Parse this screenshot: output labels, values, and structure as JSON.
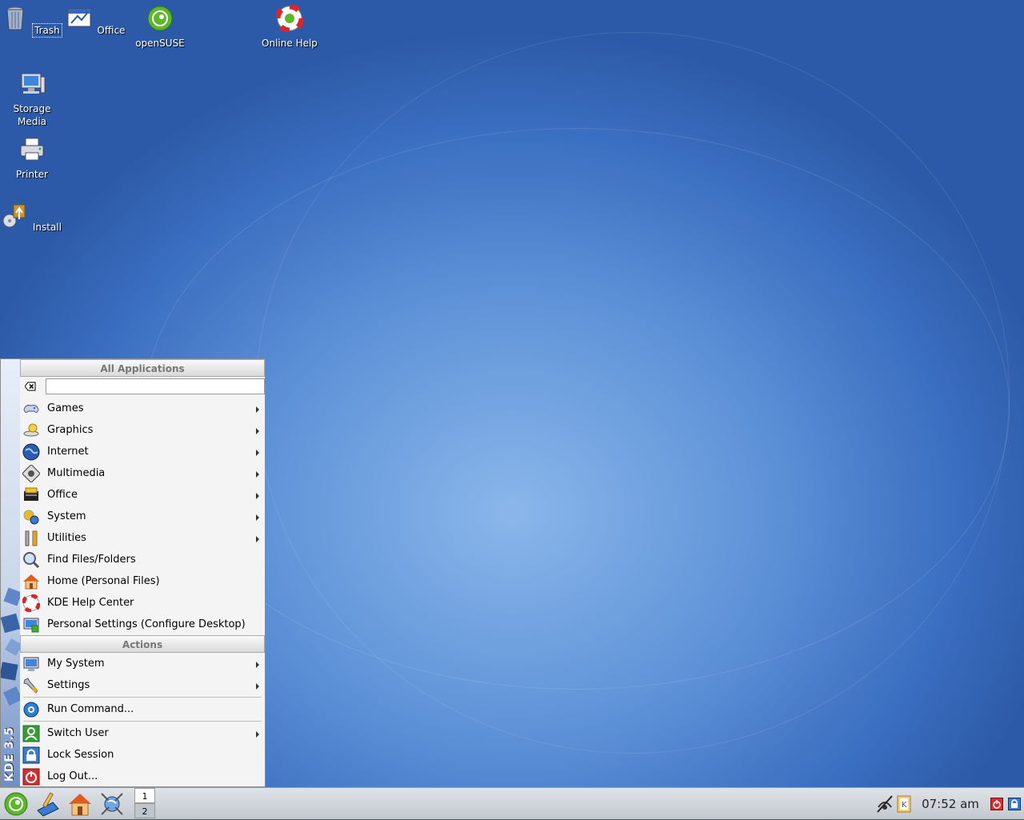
{
  "desktop": {
    "icons": [
      {
        "label": "Trash",
        "icon": "trash-icon"
      },
      {
        "label": "Office",
        "icon": "office-icon"
      },
      {
        "label": "openSUSE",
        "icon": "opensuse-icon"
      },
      {
        "label": "Online Help",
        "icon": "help-lifebuoy-icon"
      },
      {
        "label": "Storage Media",
        "icon": "storage-media-icon"
      },
      {
        "label": "Printer",
        "icon": "printer-icon"
      },
      {
        "label": "Install",
        "icon": "install-icon"
      }
    ]
  },
  "kmenu": {
    "sidebar_label": "KDE 3.5",
    "all_apps_title": "All Applications",
    "search": {
      "value": "",
      "placeholder": ""
    },
    "app_items": [
      {
        "label": "Games",
        "icon": "games-controller-icon",
        "submenu": true
      },
      {
        "label": "Graphics",
        "icon": "graphics-icon",
        "submenu": true
      },
      {
        "label": "Internet",
        "icon": "internet-globe-icon",
        "submenu": true
      },
      {
        "label": "Multimedia",
        "icon": "multimedia-icon",
        "submenu": true
      },
      {
        "label": "Office",
        "icon": "office-icon",
        "submenu": true
      },
      {
        "label": "System",
        "icon": "system-gears-icon",
        "submenu": true
      },
      {
        "label": "Utilities",
        "icon": "utilities-icon",
        "submenu": true
      },
      {
        "label": "Find Files/Folders",
        "icon": "find-magnifier-icon",
        "submenu": false
      },
      {
        "label": "Home (Personal Files)",
        "icon": "home-icon",
        "submenu": false
      },
      {
        "label": "KDE Help Center",
        "icon": "help-lifebuoy-icon",
        "submenu": false
      },
      {
        "label": "Personal Settings (Configure Desktop)",
        "icon": "personal-settings-icon",
        "submenu": false
      }
    ],
    "actions_title": "Actions",
    "action_items": [
      {
        "label": "My System",
        "icon": "my-system-icon",
        "submenu": true
      },
      {
        "label": "Settings",
        "icon": "settings-wrench-icon",
        "submenu": true
      },
      {
        "label": "Run Command...",
        "icon": "run-command-icon",
        "submenu": false
      },
      {
        "label": "Switch User",
        "icon": "switch-user-icon",
        "submenu": true
      },
      {
        "label": "Lock Session",
        "icon": "lock-icon",
        "submenu": false
      },
      {
        "label": "Log Out...",
        "icon": "logout-icon",
        "submenu": false
      }
    ]
  },
  "taskbar": {
    "quick_launch": [
      {
        "icon": "kmenu-suse-icon"
      },
      {
        "icon": "office-writer-icon"
      },
      {
        "icon": "home-icon"
      },
      {
        "icon": "konqueror-icon"
      }
    ],
    "pager": [
      "1",
      "2"
    ],
    "active_desktop": "1",
    "tray": [
      {
        "icon": "network-disconnected-icon"
      },
      {
        "icon": "klipper-icon"
      }
    ],
    "clock": "07:52 am",
    "right_buttons": [
      {
        "icon": "power-icon"
      },
      {
        "icon": "lock-screen-icon"
      }
    ]
  }
}
